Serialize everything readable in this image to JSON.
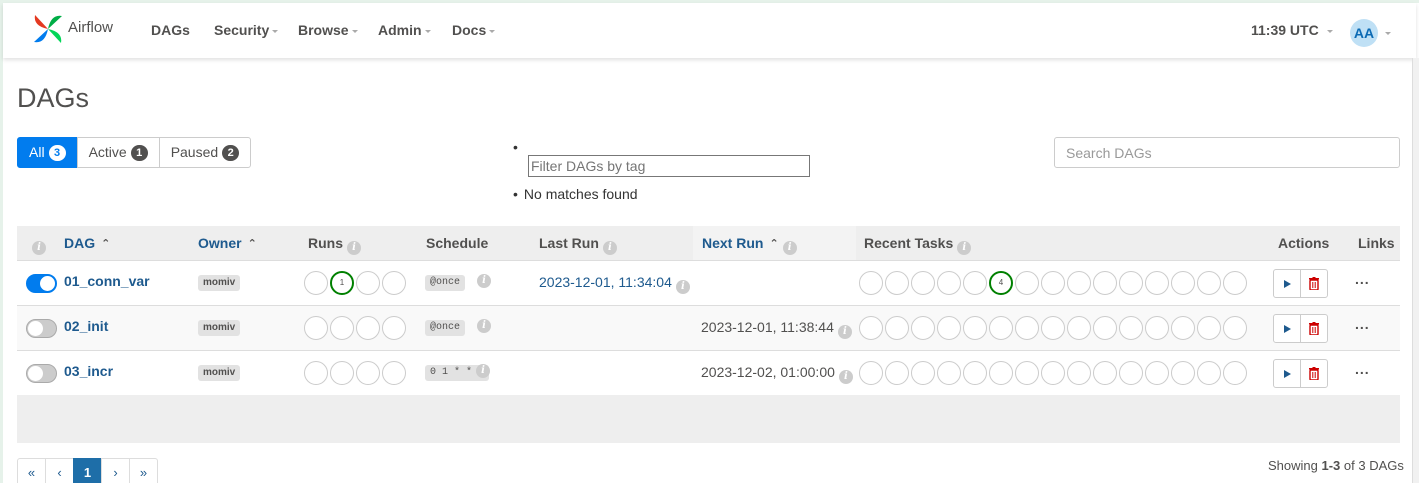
{
  "navbar": {
    "brand": "Airflow",
    "items": [
      {
        "label": "DAGs",
        "dropdown": false
      },
      {
        "label": "Security",
        "dropdown": true
      },
      {
        "label": "Browse",
        "dropdown": true
      },
      {
        "label": "Admin",
        "dropdown": true
      },
      {
        "label": "Docs",
        "dropdown": true
      }
    ],
    "clock": "11:39 UTC",
    "avatar": "AA"
  },
  "page": {
    "title": "DAGs"
  },
  "filters": {
    "all": {
      "label": "All",
      "count": "3"
    },
    "active": {
      "label": "Active",
      "count": "1"
    },
    "paused": {
      "label": "Paused",
      "count": "2"
    },
    "tag_placeholder": "Filter DAGs by tag",
    "tag_no_matches": "No matches found",
    "search_placeholder": "Search DAGs"
  },
  "table": {
    "headers": {
      "dag": "DAG",
      "owner": "Owner",
      "runs": "Runs",
      "schedule": "Schedule",
      "last_run": "Last Run",
      "next_run": "Next Run",
      "recent_tasks": "Recent Tasks",
      "actions": "Actions",
      "links": "Links"
    },
    "rows": [
      {
        "dag_id": "01_conn_var",
        "paused": false,
        "owner": "momiv",
        "runs_success": "1",
        "schedule": "@once",
        "last_run": "2023-12-01, 11:34:04",
        "next_run": "",
        "tasks_success": "4"
      },
      {
        "dag_id": "02_init",
        "paused": true,
        "owner": "momiv",
        "runs_success": "",
        "schedule": "@once",
        "last_run": "",
        "next_run": "2023-12-01, 11:38:44",
        "tasks_success": ""
      },
      {
        "dag_id": "03_incr",
        "paused": true,
        "owner": "momiv",
        "runs_success": "",
        "schedule": "0 1 * * *",
        "last_run": "",
        "next_run": "2023-12-02, 01:00:00",
        "tasks_success": ""
      }
    ],
    "links_label": "..."
  },
  "pagination": {
    "first": "«",
    "prev": "‹",
    "current": "1",
    "next": "›",
    "last": "»",
    "showing_prefix": "Showing ",
    "showing_range": "1-3",
    "showing_suffix": " of 3 DAGs"
  },
  "colors": {
    "accent": "#017cee",
    "success": "#008000",
    "link": "#1e5a8e",
    "delete": "#cc0000"
  }
}
